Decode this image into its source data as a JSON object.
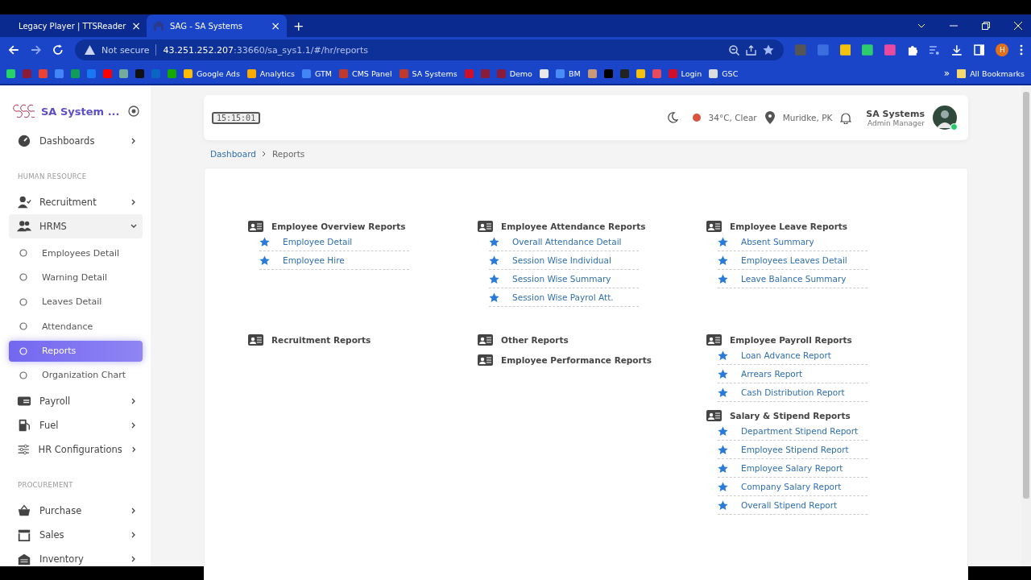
{
  "browser": {
    "tabs": [
      {
        "title": "Legacy Player | TTSReader",
        "selected": false,
        "close": "×"
      },
      {
        "title": "SAG - SA Systems",
        "selected": true,
        "close": "×"
      }
    ],
    "new_tab": "+",
    "address": {
      "security": "Not secure",
      "host": "43.251.252.207",
      "path": ":33660/sa_sys1.1/#/hr/reports"
    },
    "bookmarks": [
      {
        "color": "#25d366"
      },
      {
        "color": "#8a1c3a"
      },
      {
        "color": "#ea4335"
      },
      {
        "color": "#4285f4"
      },
      {
        "color": "#0f9d58"
      },
      {
        "color": "#1877f2"
      },
      {
        "color": "#ff0000"
      },
      {
        "color": "#74aa9c"
      },
      {
        "color": "#111111"
      },
      {
        "color": "#0a66c2"
      },
      {
        "color": "#14a800"
      },
      {
        "label": "Google Ads",
        "color": "#fbbc04"
      },
      {
        "label": "Analytics",
        "color": "#f9ab00"
      },
      {
        "label": "GTM",
        "color": "#4285f4"
      },
      {
        "label": "CMS Panel",
        "color": "#c0392b"
      },
      {
        "label": "SA Systems",
        "color": "#c0392b"
      },
      {
        "color": "#d0102a"
      },
      {
        "color": "#8a1c3a"
      },
      {
        "label": "Demo",
        "color": "#8a1c3a"
      },
      {
        "color": "#e8e8e8"
      },
      {
        "label": "BM",
        "color": "#4a8cf7"
      },
      {
        "color": "#c89a7a"
      },
      {
        "color": "#000000"
      },
      {
        "color": "#222222"
      },
      {
        "color": "#f4c20d"
      },
      {
        "color": "#e84a5f"
      },
      {
        "label": "Login",
        "color": "#d0102a"
      },
      {
        "label": "GSC",
        "color": "#dddddd"
      }
    ],
    "more": "»",
    "all_bookmarks": "All Bookmarks",
    "profile": "H"
  },
  "sidebar": {
    "brand": "SA System ...",
    "sections": [
      {
        "items": [
          {
            "label": "Dashboards",
            "kind": "menu",
            "selected": false,
            "expanded": false
          }
        ]
      },
      {
        "heading": "HUMAN RESOURCE",
        "items": [
          {
            "label": "Recruitment",
            "kind": "menu",
            "selected": false,
            "expanded": false
          },
          {
            "label": "HRMS",
            "kind": "menu",
            "selected": false,
            "expanded": true
          },
          {
            "label": "Employees Detail",
            "kind": "sub",
            "selected": false
          },
          {
            "label": "Warning Detail",
            "kind": "sub",
            "selected": false
          },
          {
            "label": "Leaves Detail",
            "kind": "sub",
            "selected": false
          },
          {
            "label": "Attendance",
            "kind": "sub",
            "selected": false
          },
          {
            "label": "Reports",
            "kind": "sub",
            "selected": true
          },
          {
            "label": "Organization Chart",
            "kind": "sub",
            "selected": false
          },
          {
            "label": "Payroll",
            "kind": "menu",
            "selected": false,
            "expanded": false
          },
          {
            "label": "Fuel",
            "kind": "menu",
            "selected": false,
            "expanded": false
          },
          {
            "label": "HR Configurations",
            "kind": "menu",
            "selected": false,
            "expanded": false
          }
        ]
      },
      {
        "heading": "PROCUREMENT",
        "items": [
          {
            "label": "Purchase",
            "kind": "menu",
            "selected": false,
            "expanded": false
          },
          {
            "label": "Sales",
            "kind": "menu",
            "selected": false,
            "expanded": false
          },
          {
            "label": "Inventory",
            "kind": "menu",
            "selected": false,
            "expanded": false
          }
        ]
      }
    ]
  },
  "header": {
    "clock": "15:15:01",
    "weather": "34°C, Clear",
    "location": "Muridke, PK",
    "user": {
      "name": "SA Systems",
      "role": "Admin Manager",
      "online": true
    }
  },
  "breadcrumb": [
    "Dashboard",
    "Reports"
  ],
  "report_rows": [
    [
      [
        {
          "title": "Employee Overview Reports",
          "links": [
            "Employee Detail",
            "Employee Hire"
          ]
        }
      ],
      [
        {
          "title": "Employee Attendance Reports",
          "links": [
            "Overall Attendance Detail",
            "Session Wise Individual",
            "Session Wise Summary",
            "Session Wise Payrol Att."
          ]
        }
      ],
      [
        {
          "title": "Employee Leave Reports",
          "links": [
            "Absent Summary",
            "Employees Leaves Detail",
            "Leave Balance Summary"
          ]
        }
      ]
    ],
    [
      [
        {
          "title": "Recruitment Reports"
        }
      ],
      [
        {
          "title": "Other Reports"
        },
        {
          "title": "Employee Performance Reports"
        }
      ],
      [
        {
          "title": "Employee Payroll Reports",
          "links": [
            "Loan Advance Report",
            "Arrears Report",
            "Cash Distribution Report"
          ]
        },
        {
          "title": "Salary & Stipend Reports",
          "links": [
            "Department Stipend Report",
            "Employee Stipend Report",
            "Employee Salary Report",
            "Company Salary Report",
            "Overall Stipend Report"
          ]
        }
      ]
    ]
  ]
}
